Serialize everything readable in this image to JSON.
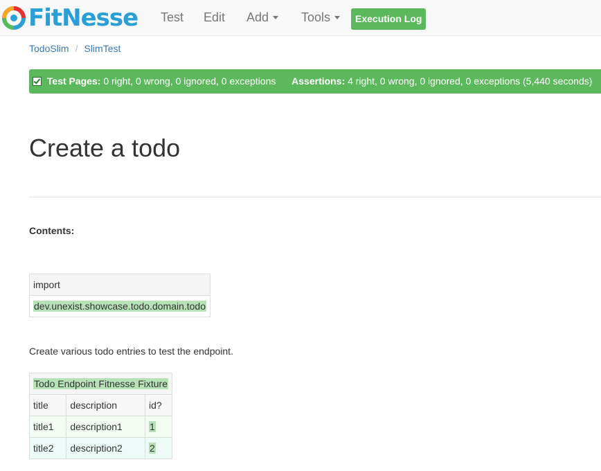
{
  "brand": {
    "name": "FitNesse"
  },
  "nav": {
    "test": "Test",
    "edit": "Edit",
    "add": "Add",
    "tools": "Tools",
    "execution_log": "Execution Log"
  },
  "breadcrumb": [
    "TodoSlim",
    "SlimTest"
  ],
  "status": {
    "test_pages_label": "Test Pages:",
    "test_pages_value": "0 right, 0 wrong, 0 ignored, 0 exceptions",
    "assertions_label": "Assertions:",
    "assertions_value": "4 right, 0 wrong, 0 ignored, 0 exceptions (5,440 seconds)",
    "color": "#5cb85c"
  },
  "page": {
    "title": "Create a todo",
    "contents_label": "Contents:",
    "description": "Create various todo entries to test the endpoint."
  },
  "import_table": {
    "header": "import",
    "value": "dev.unexist.showcase.todo.domain.todo"
  },
  "fixture_table": {
    "name": "Todo Endpoint Fitnesse Fixture",
    "columns": [
      "title",
      "description",
      "id?"
    ],
    "rows": [
      [
        "title1",
        "description1",
        "1"
      ],
      [
        "title2",
        "description2",
        "2"
      ]
    ]
  }
}
